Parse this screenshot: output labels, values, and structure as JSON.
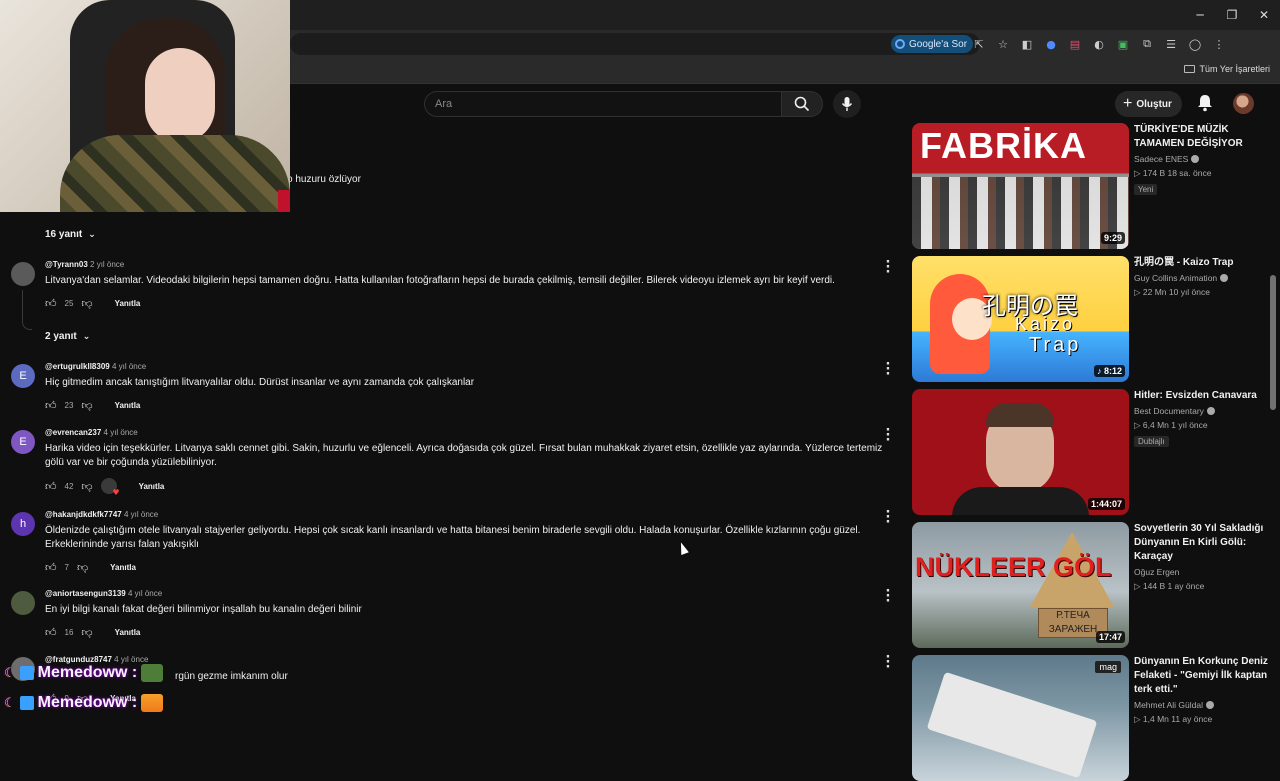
{
  "browser": {
    "google_sor": "Google'a Sor",
    "all_bookmarks": "Tüm Yer İşaretleri",
    "window_controls": {
      "minimize": "─",
      "restore": "❐",
      "close": "✕"
    }
  },
  "header": {
    "search_placeholder": "Ara",
    "create_label": "Oluştur"
  },
  "comments": {
    "fragment_text": "o huzuru özlüyor",
    "reply_toggle_1": "16 yanıt",
    "reply_toggle_2": "2 yanıt",
    "reply_label": "Yanıtla",
    "items": [
      {
        "author": "@Tyrann03",
        "time": "2 yıl önce",
        "text": "Litvanya'dan selamlar. Videodaki bilgilerin hepsi tamamen doğru. Hatta kullanılan fotoğrafların hepsi de burada çekilmiş, temsili değiller. Bilerek videoyu izlemek ayrı bir keyif verdi.",
        "likes": "25",
        "avatar_color": "#5a5a5a",
        "avatar_letter": ""
      },
      {
        "author": "@ertugrulkll8309",
        "time": "4 yıl önce",
        "text": "Hiç gitmedim ancak tanıştığım litvanyalılar oldu. Dürüst insanlar ve aynı zamanda çok çalışkanlar",
        "likes": "23",
        "avatar_color": "#5c6bc0",
        "avatar_letter": "E"
      },
      {
        "author": "@evrencan237",
        "time": "4 yıl önce",
        "text": "Harika video için teşekkürler. Litvanya saklı cennet gibi. Sakin, huzurlu ve eğlenceli. Ayrıca doğasıda çok güzel. Fırsat bulan muhakkak ziyaret etsin, özellikle yaz aylarında. Yüzlerce tertemiz gölü var ve bir çoğunda yüzülebiliniyor.",
        "likes": "42",
        "avatar_color": "#7e57c2",
        "avatar_letter": "E"
      },
      {
        "author": "@hakanjdkdkfk7747",
        "time": "4 yıl önce",
        "text": "Öldenizde çalıştığım otele litvanyalı stajyerler geliyordu. Hepsi çok sıcak kanlı insanlardı ve hatta bitanesi benim biraderle sevgili oldu. Halada konuşurlar. Özellikle kızlarının çoğu güzel. Erkeklerininde yarısı falan yakışıklı",
        "likes": "7",
        "avatar_color": "#5e35b1",
        "avatar_letter": "h"
      },
      {
        "author": "@aniortasengun3139",
        "time": "4 yıl önce",
        "text": "En iyi bilgi kanalı fakat değeri bilinmiyor inşallah bu kanalın değeri bilinir",
        "likes": "16",
        "avatar_color": "#4e5b3e",
        "avatar_letter": ""
      },
      {
        "author": "@fratgunduz8747",
        "time": "4 yıl önce",
        "text": "rgün gezme imkanım olur",
        "likes": "9",
        "avatar_color": "#6d6d6d",
        "avatar_letter": ""
      }
    ]
  },
  "chat_overlay": {
    "lines": [
      {
        "user": "Memedoww :"
      },
      {
        "user": "Memedoww :"
      }
    ]
  },
  "sidebar": {
    "videos": [
      {
        "title": "TÜRKİYE'DE MÜZİK TAMAMEN DEĞİŞİYOR",
        "channel": "Sadece ENES",
        "meta": "▷ 174 B   18 sa. önce",
        "tag": "Yeni",
        "duration": "9:29",
        "thumb_text": "FABRİKA"
      },
      {
        "title": "孔明の罠 - Kaizo Trap",
        "channel": "Guy Collins Animation",
        "meta": "▷ 22 Mn   10 yıl önce",
        "tag": "",
        "duration": "♪ 8:12",
        "thumb_text": "孔明の罠",
        "thumb_text2": "Kaizo",
        "thumb_text3": "Trap"
      },
      {
        "title": "Hitler: Evsizden Canavara",
        "channel": "Best Documentary",
        "meta": "▷ 6,4 Mn   1 yıl önce",
        "tag": "Dublajlı",
        "duration": "1:44:07"
      },
      {
        "title": "Sovyetlerin 30 Yıl Sakladığı Dünyanın En Kirli Gölü: Karaçay",
        "channel": "Oğuz Ergen",
        "meta": "▷ 144 B   1 ay önce",
        "tag": "",
        "duration": "17:47",
        "thumb_text": "NÜKLEER GÖL",
        "plank_text": "Р.ТЕЧА ЗАРАЖЕН"
      },
      {
        "title": "Dünyanın En Korkunç Deniz Felaketi - \"Gemiyi İlk kaptan terk etti.\"",
        "channel": "Mehmet Ali Güldal",
        "meta": "▷ 1,4 Mn   11 ay önce",
        "tag": "",
        "duration": "",
        "badge": "mag"
      }
    ]
  }
}
